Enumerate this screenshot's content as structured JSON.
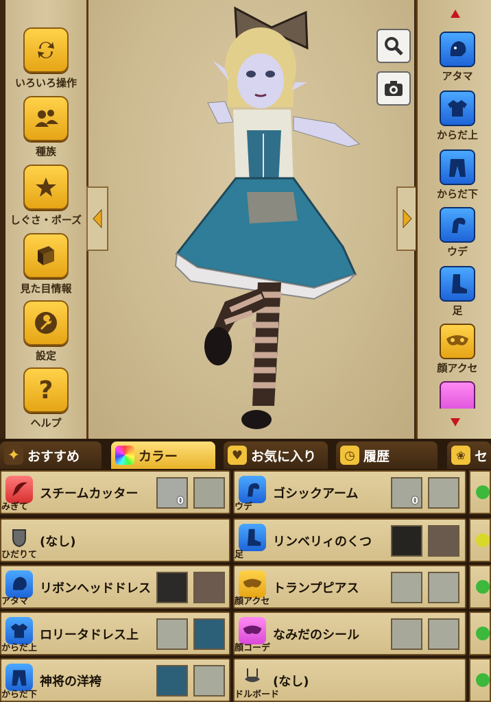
{
  "left_menu": [
    {
      "label": "いろいろ操作",
      "icon": "refresh-icon"
    },
    {
      "label": "種族",
      "icon": "people-icon"
    },
    {
      "label": "しぐさ・ポーズ",
      "icon": "star-icon"
    },
    {
      "label": "見た目情報",
      "icon": "book-icon"
    },
    {
      "label": "設定",
      "icon": "wrench-icon"
    },
    {
      "label": "ヘルプ",
      "icon": "question-icon"
    }
  ],
  "right_menu": [
    {
      "label": "アタマ",
      "icon": "head-icon",
      "color": "#2a7ae8"
    },
    {
      "label": "からだ上",
      "icon": "shirt-icon",
      "color": "#2a7ae8"
    },
    {
      "label": "からだ下",
      "icon": "pants-icon",
      "color": "#2a7ae8"
    },
    {
      "label": "ウデ",
      "icon": "arm-icon",
      "color": "#2a7ae8"
    },
    {
      "label": "足",
      "icon": "boot-icon",
      "color": "#2a7ae8"
    },
    {
      "label": "顔アクセ",
      "icon": "mask-icon",
      "color": "#f2b51c"
    }
  ],
  "tools": {
    "search": "search-icon",
    "camera": "camera-icon"
  },
  "tabs": [
    {
      "label": "おすすめ",
      "icon": "sparkle-icon",
      "active": false
    },
    {
      "label": "カラー",
      "icon": "rainbow-icon",
      "active": true
    },
    {
      "label": "お気に入り",
      "icon": "heart-icon",
      "active": false
    },
    {
      "label": "履歴",
      "icon": "history-icon",
      "active": false
    },
    {
      "label": "セ",
      "icon": "set-icon",
      "active": false
    }
  ],
  "items": [
    {
      "slot": "みぎて",
      "name": "スチームカッター",
      "icon_color": "#e84a4a",
      "colors": [
        "#a8aaa4",
        "#a3a596"
      ],
      "numbers": [
        "0",
        ""
      ]
    },
    {
      "slot": "ウデ",
      "name": "ゴシックアーム",
      "icon_color": "#2a7ae8",
      "colors": [
        "#a5a89a",
        "#a8aa9c"
      ],
      "numbers": [
        "0",
        ""
      ]
    },
    {
      "slot": "ひだりて",
      "name": "(なし)",
      "icon_color": "",
      "colors": [],
      "numbers": []
    },
    {
      "slot": "足",
      "name": "リンベリィのくつ",
      "icon_color": "#2a7ae8",
      "colors": [
        "#262421",
        "#6a5a4e"
      ],
      "numbers": [
        "",
        ""
      ]
    },
    {
      "slot": "アタマ",
      "name": "リボンヘッドドレス",
      "icon_color": "#2a7ae8",
      "colors": [
        "#2c2a28",
        "#6c5a4e"
      ],
      "numbers": [
        "",
        ""
      ]
    },
    {
      "slot": "顔アクセ",
      "name": "トランプピアス",
      "icon_color": "#f2b51c",
      "colors": [
        "#a8aa9c",
        "#a8aa9e"
      ],
      "numbers": [
        "",
        ""
      ]
    },
    {
      "slot": "からだ上",
      "name": "ロリータドレス上",
      "icon_color": "#2a7ae8",
      "colors": [
        "#a8aa9c",
        "#2c5f78"
      ],
      "numbers": [
        "",
        ""
      ]
    },
    {
      "slot": "顔コーデ",
      "name": "なみだのシール",
      "icon_color": "#d94ad9",
      "colors": [
        "#a8a89a",
        "#a8aa9c"
      ],
      "numbers": [
        "",
        ""
      ]
    },
    {
      "slot": "からだ下",
      "name": "神将の洋袴",
      "icon_color": "#2a7ae8",
      "colors": [
        "#2c5f78",
        "#a8aa9c"
      ],
      "numbers": [
        "",
        ""
      ]
    },
    {
      "slot": "ドルボード",
      "name": "(なし)",
      "icon_color": "",
      "colors": [],
      "numbers": []
    }
  ],
  "edge_colors": [
    "#3cb83c",
    "#d8d82a",
    "#3cb83c",
    "#3cb83c",
    "#3cb83c"
  ]
}
